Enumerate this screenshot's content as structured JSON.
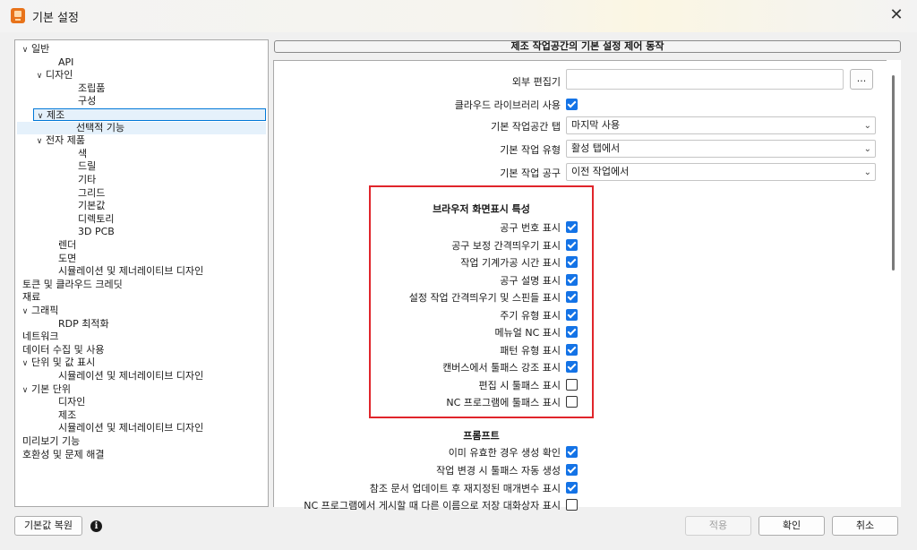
{
  "window": {
    "title": "기본 설정",
    "close_glyph": "✕"
  },
  "tree": {
    "items": [
      {
        "label": "일반",
        "level": 0,
        "chevron": "v"
      },
      {
        "label": "API",
        "level": 2
      },
      {
        "label": "디자인",
        "level": 1,
        "chevron": "v"
      },
      {
        "label": "조립품",
        "level": 3
      },
      {
        "label": "구성",
        "level": 3
      },
      {
        "label": "제조",
        "level": 1,
        "chevron": "v",
        "selected": true
      },
      {
        "label": "선택적 기능",
        "level": 3
      },
      {
        "label": "전자 제품",
        "level": 1,
        "chevron": "v"
      },
      {
        "label": "색",
        "level": 3
      },
      {
        "label": "드릴",
        "level": 3
      },
      {
        "label": "기타",
        "level": 3
      },
      {
        "label": "그리드",
        "level": 3
      },
      {
        "label": "기본값",
        "level": 3
      },
      {
        "label": "디렉토리",
        "level": 3
      },
      {
        "label": "3D PCB",
        "level": 3
      },
      {
        "label": "렌더",
        "level": 2
      },
      {
        "label": "도면",
        "level": 2
      },
      {
        "label": "시뮬레이션 및 제너레이티브 디자인",
        "level": 2
      },
      {
        "label": "토큰 및 클라우드 크레딧",
        "level": 0
      },
      {
        "label": "재료",
        "level": 0
      },
      {
        "label": "그래픽",
        "level": 0,
        "chevron": "v"
      },
      {
        "label": "RDP 최적화",
        "level": 2
      },
      {
        "label": "네트워크",
        "level": 0
      },
      {
        "label": "데이터 수집 및 사용",
        "level": 0
      },
      {
        "label": "단위 및 값 표시",
        "level": 0,
        "chevron": "v"
      },
      {
        "label": "시뮬레이션 및 제너레이티브 디자인",
        "level": 2
      },
      {
        "label": "기본 단위",
        "level": 0,
        "chevron": "v"
      },
      {
        "label": "디자인",
        "level": 2
      },
      {
        "label": "제조",
        "level": 2
      },
      {
        "label": "시뮬레이션 및 제너레이티브 디자인",
        "level": 2
      },
      {
        "label": "미리보기 기능",
        "level": 0
      },
      {
        "label": "호환성 및 문제 해결",
        "level": 0
      }
    ]
  },
  "panel": {
    "header": "제조 작업공간의 기본 설정 제어 동작",
    "external_editor": {
      "label": "외부 편집기",
      "value": "",
      "browse_label": "..."
    },
    "cloud_library": {
      "label": "클라우드 라이브러리 사용",
      "checked": true
    },
    "default_tab": {
      "label": "기본 작업공간 탭",
      "value": "마지막 사용"
    },
    "default_op_type": {
      "label": "기본 작업 유형",
      "value": "활성 탭에서"
    },
    "default_op_tool": {
      "label": "기본 작업 공구",
      "value": "이전 작업에서"
    },
    "browser_section": {
      "title": "브라우저 화면표시 특성",
      "items": [
        {
          "label": "공구 번호 표시",
          "checked": true
        },
        {
          "label": "공구 보정 간격띄우기 표시",
          "checked": true
        },
        {
          "label": "작업 기계가공 시간 표시",
          "checked": true
        },
        {
          "label": "공구 설명 표시",
          "checked": true
        },
        {
          "label": "설정 작업 간격띄우기 및 스핀들 표시",
          "checked": true
        },
        {
          "label": "주기 유형 표시",
          "checked": true
        },
        {
          "label": "메뉴얼 NC 표시",
          "checked": true
        },
        {
          "label": "패턴 유형 표시",
          "checked": true
        },
        {
          "label": "캔버스에서 툴패스 강조 표시",
          "checked": true
        },
        {
          "label": "편집 시 툴패스 표시",
          "checked": false
        },
        {
          "label": "NC 프로그램에 툴패스 표시",
          "checked": false
        }
      ]
    },
    "prompt_section": {
      "title": "프롬프트",
      "items": [
        {
          "label": "이미 유효한 경우 생성 확인",
          "checked": true
        },
        {
          "label": "작업 변경 시 툴패스 자동 생성",
          "checked": true
        },
        {
          "label": "참조 문서 업데이트 후 재지정된 매개변수 표시",
          "checked": true
        },
        {
          "label": "NC 프로그램에서 게시할 때 다른 이름으로 저장 대화상자 표시",
          "checked": false
        }
      ]
    }
  },
  "footer": {
    "restore_label": "기본값 복원",
    "info_glyph": "i",
    "apply_label": "적용",
    "ok_label": "확인",
    "cancel_label": "취소"
  },
  "colors": {
    "accent": "#1473e6",
    "highlight_box": "#e0252b",
    "selection": "#0078d7"
  },
  "icons": {
    "app": "fusion-app-icon",
    "close": "close-icon",
    "chevron": "chevron-down-icon",
    "checkbox": "checkbox-icon",
    "info": "info-icon"
  }
}
